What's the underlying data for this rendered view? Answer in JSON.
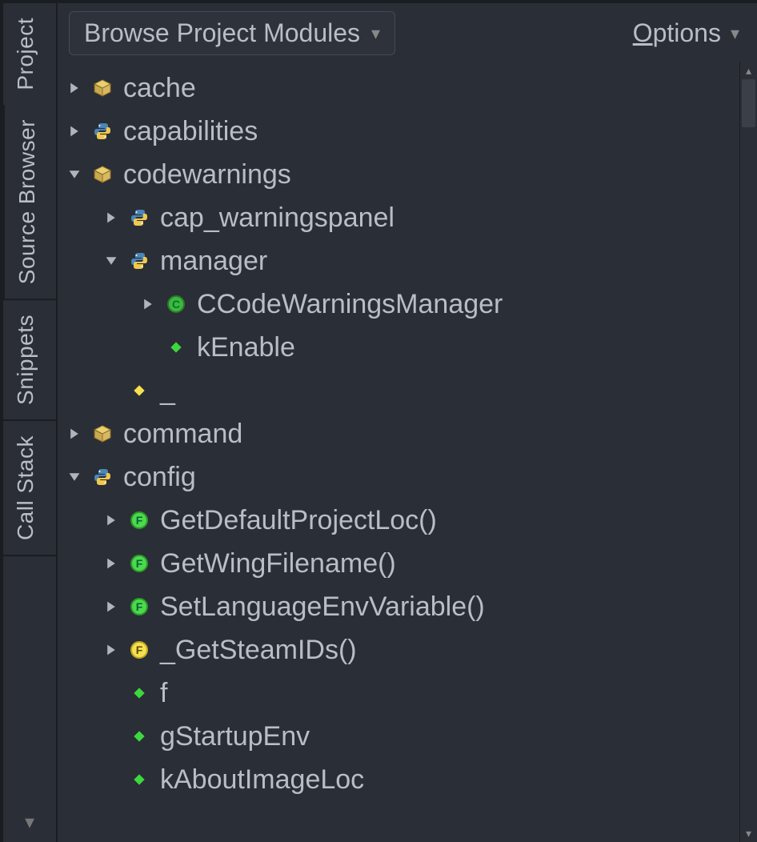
{
  "tabs": {
    "project": "Project",
    "source_browser": "Source Browser",
    "snippets": "Snippets",
    "call_stack": "Call Stack"
  },
  "toolbar": {
    "browse_label": "Browse Project Modules",
    "options_prefix": "O",
    "options_rest": "ptions"
  },
  "tree": [
    {
      "depth": 0,
      "expander": "right",
      "icon": "package",
      "label": "cache"
    },
    {
      "depth": 0,
      "expander": "right",
      "icon": "python",
      "label": "capabilities"
    },
    {
      "depth": 0,
      "expander": "down",
      "icon": "package",
      "label": "codewarnings"
    },
    {
      "depth": 1,
      "expander": "right",
      "icon": "python",
      "label": "cap_warningspanel"
    },
    {
      "depth": 1,
      "expander": "down",
      "icon": "python",
      "label": "manager"
    },
    {
      "depth": 2,
      "expander": "right",
      "icon": "class",
      "label": "CCodeWarningsManager"
    },
    {
      "depth": 2,
      "expander": "",
      "icon": "diamond-green",
      "label": "kEnable"
    },
    {
      "depth": 1,
      "expander": "",
      "icon": "diamond-yellow",
      "label": "_"
    },
    {
      "depth": 0,
      "expander": "right",
      "icon": "package",
      "label": "command"
    },
    {
      "depth": 0,
      "expander": "down",
      "icon": "python",
      "label": "config"
    },
    {
      "depth": 1,
      "expander": "right",
      "icon": "func-green",
      "label": "GetDefaultProjectLoc()"
    },
    {
      "depth": 1,
      "expander": "right",
      "icon": "func-green",
      "label": "GetWingFilename()"
    },
    {
      "depth": 1,
      "expander": "right",
      "icon": "func-green",
      "label": "SetLanguageEnvVariable()"
    },
    {
      "depth": 1,
      "expander": "right",
      "icon": "func-yellow",
      "label": "_GetSteamIDs()"
    },
    {
      "depth": 1,
      "expander": "",
      "icon": "diamond-green",
      "label": "f"
    },
    {
      "depth": 1,
      "expander": "",
      "icon": "diamond-green",
      "label": "gStartupEnv"
    },
    {
      "depth": 1,
      "expander": "",
      "icon": "diamond-green",
      "label": "kAboutImageLoc"
    }
  ]
}
